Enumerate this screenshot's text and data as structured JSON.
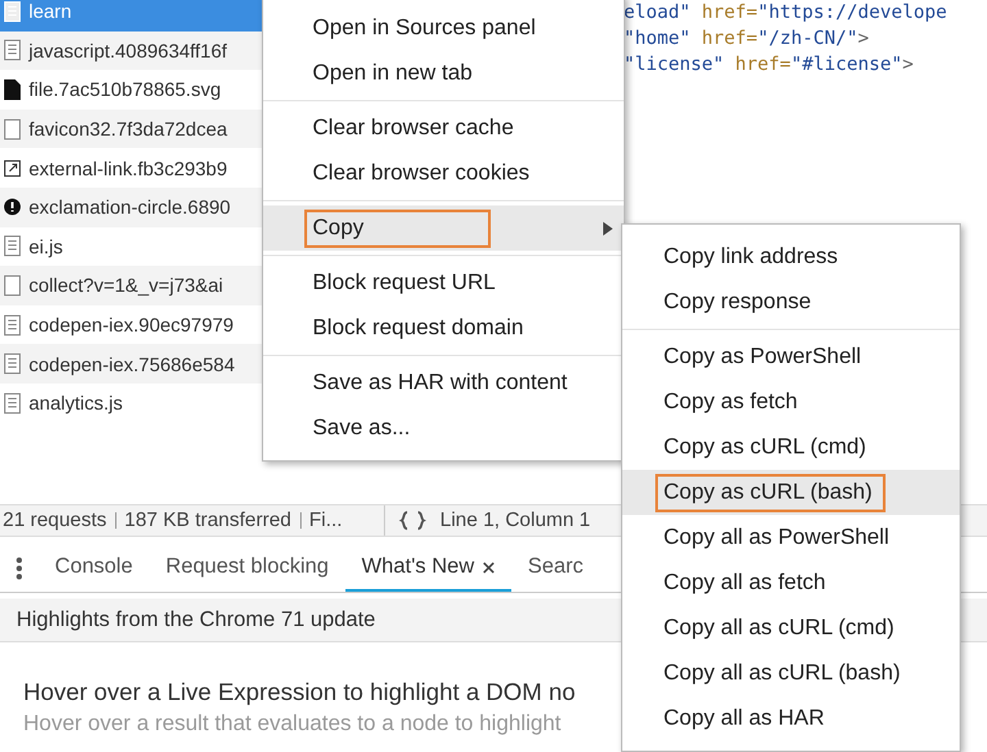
{
  "files": [
    {
      "name": "learn",
      "kind": "doc",
      "selected": true
    },
    {
      "name": "javascript.4089634ff16f",
      "kind": "doc",
      "selected": false
    },
    {
      "name": "file.7ac510b78865.svg",
      "kind": "file",
      "selected": false
    },
    {
      "name": "favicon32.7f3da72dcea",
      "kind": "blank",
      "selected": false
    },
    {
      "name": "external-link.fb3c293b9",
      "kind": "link",
      "selected": false
    },
    {
      "name": "exclamation-circle.6890",
      "kind": "alert",
      "selected": false
    },
    {
      "name": "ei.js",
      "kind": "doc",
      "selected": false
    },
    {
      "name": "collect?v=1&_v=j73&ai",
      "kind": "blank",
      "selected": false
    },
    {
      "name": "codepen-iex.90ec97979",
      "kind": "doc",
      "selected": false
    },
    {
      "name": "codepen-iex.75686e584",
      "kind": "doc",
      "selected": false
    },
    {
      "name": "analytics.js",
      "kind": "doc",
      "selected": false
    }
  ],
  "code_lines": [
    [
      {
        "t": "eload\"",
        "kind": "value"
      },
      {
        "t": " href=",
        "kind": "attr"
      },
      {
        "t": "\"https://develope",
        "kind": "value"
      }
    ],
    [
      {
        "t": "\"home\"",
        "kind": "value"
      },
      {
        "t": " href=",
        "kind": "attr"
      },
      {
        "t": "\"/zh-CN/\"",
        "kind": "value"
      },
      {
        "t": ">",
        "kind": "tag"
      }
    ],
    [
      {
        "t": "\"license\"",
        "kind": "value"
      },
      {
        "t": " href=",
        "kind": "attr"
      },
      {
        "t": "\"#license\"",
        "kind": "value"
      },
      {
        "t": ">",
        "kind": "tag"
      }
    ]
  ],
  "status_bar": {
    "summary": [
      "21 requests",
      "187 KB transferred",
      "Fi..."
    ],
    "position": "Line 1, Column 1"
  },
  "drawer_tabs": [
    {
      "label": "Console",
      "selected": false,
      "closable": false
    },
    {
      "label": "Request blocking",
      "selected": false,
      "closable": false
    },
    {
      "label": "What's New",
      "selected": true,
      "closable": true
    },
    {
      "label": "Searc",
      "selected": false,
      "closable": false
    }
  ],
  "drawer_header": "Highlights from the Chrome 71 update",
  "article": {
    "heading": "Hover over a Live Expression to highlight a DOM no",
    "text": "Hover over a result that evaluates to a node to highlight"
  },
  "context_menu": [
    [
      {
        "label": "Open in Sources panel",
        "selected": false,
        "submenu": false
      },
      {
        "label": "Open in new tab",
        "selected": false,
        "submenu": false
      }
    ],
    [
      {
        "label": "Clear browser cache",
        "selected": false,
        "submenu": false
      },
      {
        "label": "Clear browser cookies",
        "selected": false,
        "submenu": false
      }
    ],
    [
      {
        "label": "Copy",
        "selected": true,
        "submenu": true
      }
    ],
    [
      {
        "label": "Block request URL",
        "selected": false,
        "submenu": false
      },
      {
        "label": "Block request domain",
        "selected": false,
        "submenu": false
      }
    ],
    [
      {
        "label": "Save as HAR with content",
        "selected": false,
        "submenu": false
      },
      {
        "label": "Save as...",
        "selected": false,
        "submenu": false
      }
    ]
  ],
  "copy_submenu": [
    [
      {
        "label": "Copy link address",
        "selected": false
      },
      {
        "label": "Copy response",
        "selected": false
      }
    ],
    [
      {
        "label": "Copy as PowerShell",
        "selected": false
      },
      {
        "label": "Copy as fetch",
        "selected": false
      },
      {
        "label": "Copy as cURL (cmd)",
        "selected": false
      },
      {
        "label": "Copy as cURL (bash)",
        "selected": true
      },
      {
        "label": "Copy all as PowerShell",
        "selected": false
      },
      {
        "label": "Copy all as fetch",
        "selected": false
      },
      {
        "label": "Copy all as cURL (cmd)",
        "selected": false
      },
      {
        "label": "Copy all as cURL (bash)",
        "selected": false
      },
      {
        "label": "Copy all as HAR",
        "selected": false
      }
    ]
  ]
}
